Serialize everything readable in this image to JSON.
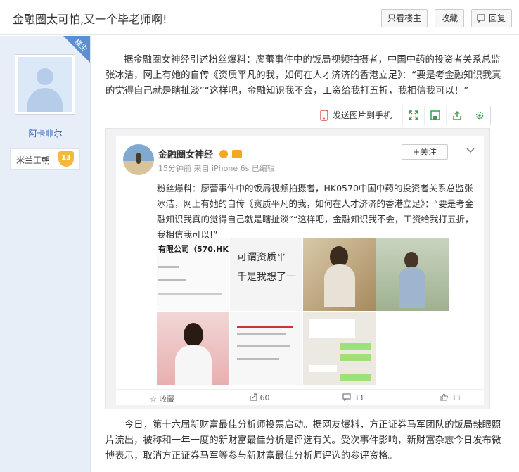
{
  "thread": {
    "title": "金融圈太可怕,又一个毕老师啊!",
    "buttons": {
      "only_op": "只看楼主",
      "favorite": "收藏",
      "reply": "回复"
    }
  },
  "author": {
    "role_tag": "楼主",
    "username": "阿卡非尔",
    "badge_name": "米兰王朝",
    "badge_level": "13"
  },
  "post": {
    "paragraph1": "据金融圈女神经引述粉丝爆料：廖蕾事件中的饭局视频拍摄者，中国中药的投资者关系总监张冰洁，网上有她的自传《资质平凡的我，如何在人才济济的香港立足》：“要是考金融知识我真的觉得自己就是瞎扯淡”“这样吧，金融知识我不会，工资给我打五折，我相信我可以！”",
    "paragraph2": "今日，第十六届新财富最佳分析师投票启动。据网友爆料，方正证券马军团队的饭局辣眼照片流出，被称和一年一度的新财富最佳分析是评选有关。受次事件影响，新财富杂志今日发布微博表示，取消方正证券马军等参与新财富最佳分析师评选的参评资格。"
  },
  "image_toolbar": {
    "send_label": "发送图片到手机"
  },
  "weibo": {
    "account": "金融圈女神经",
    "meta": "15分钟前 来自 iPhone 6s   已编辑",
    "follow": "+关注",
    "text": "粉丝爆料：廖蕾事件中的饭局视频拍摄者，HK0570中国中药的投资者关系总监张冰洁，网上有她的自传《资质平凡的我，如何在人才济济的香港立足》：“要是考金融知识我真的觉得自己就是瞎扯淡”“这样吧，金融知识我不会，工资给我打五折，我相信我可以!”",
    "img1_text": "有限公司（570.HK）",
    "img2_text": "可谓资质平\n千是我想了一",
    "actions": {
      "favorite": "收藏",
      "share": "60",
      "comment": "33",
      "like": "33"
    }
  },
  "colors": {
    "accent": "#2b64b0",
    "ribbon": "#5b8fd4",
    "sidebar": "#e7eef8",
    "weibo_orange": "#f5a623"
  }
}
